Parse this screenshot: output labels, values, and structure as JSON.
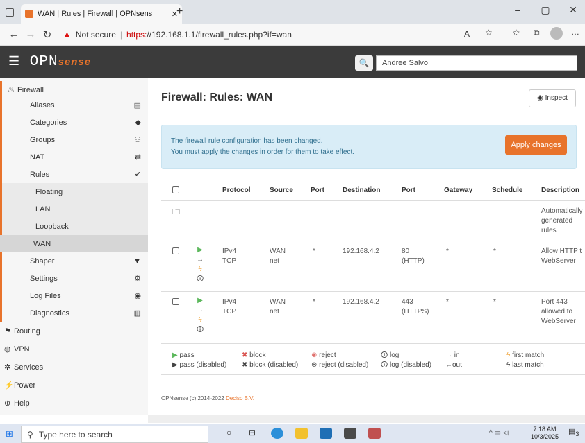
{
  "browser": {
    "tab_title": "WAN | Rules | Firewall | OPNsens",
    "not_secure": "Not secure",
    "url_scheme": "https:",
    "url_rest": "//192.168.1.1/firewall_rules.php?if=wan"
  },
  "header": {
    "logo_main": "OPN",
    "logo_sub": "sense",
    "search_value": "Andree Salvo"
  },
  "sidebar": {
    "firewall": "Firewall",
    "items": [
      {
        "label": "Aliases",
        "icon": "▤"
      },
      {
        "label": "Categories",
        "icon": "◆"
      },
      {
        "label": "Groups",
        "icon": "⚇"
      },
      {
        "label": "NAT",
        "icon": "⇄"
      },
      {
        "label": "Rules",
        "icon": "✔"
      }
    ],
    "rules_sub": [
      "Floating",
      "LAN",
      "Loopback",
      "WAN"
    ],
    "items2": [
      {
        "label": "Shaper",
        "icon": "▼"
      },
      {
        "label": "Settings",
        "icon": "⚙"
      },
      {
        "label": "Log Files",
        "icon": "◉"
      },
      {
        "label": "Diagnostics",
        "icon": "▥"
      }
    ],
    "top": [
      "Routing",
      "VPN",
      "Services",
      "Power",
      "Help"
    ]
  },
  "main": {
    "title": "Firewall: Rules: WAN",
    "inspect": "Inspect",
    "alert_line1": "The firewall rule configuration has been changed.",
    "alert_line2": "You must apply the changes in order for them to take effect.",
    "apply": "Apply changes",
    "columns": [
      "Protocol",
      "Source",
      "Port",
      "Destination",
      "Port",
      "Gateway",
      "Schedule",
      "Description"
    ],
    "auto_rules": "Automatically generated rules",
    "rows": [
      {
        "proto": "IPv4",
        "proto2": "TCP",
        "src": "WAN",
        "src2": "net",
        "sport": "*",
        "dest": "192.168.4.2",
        "dport": "80",
        "dport2": "(HTTP)",
        "gw": "*",
        "sched": "*",
        "desc": "Allow HTTP t",
        "desc2": "WebServer",
        "desc3": ""
      },
      {
        "proto": "IPv4",
        "proto2": "TCP",
        "src": "WAN",
        "src2": "net",
        "sport": "*",
        "dest": "192.168.4.2",
        "dport": "443",
        "dport2": "(HTTPS)",
        "gw": "*",
        "sched": "*",
        "desc": "Port 443",
        "desc2": "allowed to",
        "desc3": "WebServer"
      }
    ],
    "legend": {
      "pass": "pass",
      "block": "block",
      "reject": "reject",
      "log": "log",
      "in": "in",
      "first": "first match",
      "pass_d": "pass (disabled)",
      "block_d": "block (disabled)",
      "reject_d": "reject (disabled)",
      "log_d": "log (disabled)",
      "out": "out",
      "last": "last match"
    },
    "footer_a": "OPNsense (c) 2014-2022 ",
    "footer_b": "Deciso B.V."
  },
  "taskbar": {
    "search": "Type here to search",
    "time": "7:18 AM",
    "date": "10/3/2025",
    "badge": "3"
  }
}
